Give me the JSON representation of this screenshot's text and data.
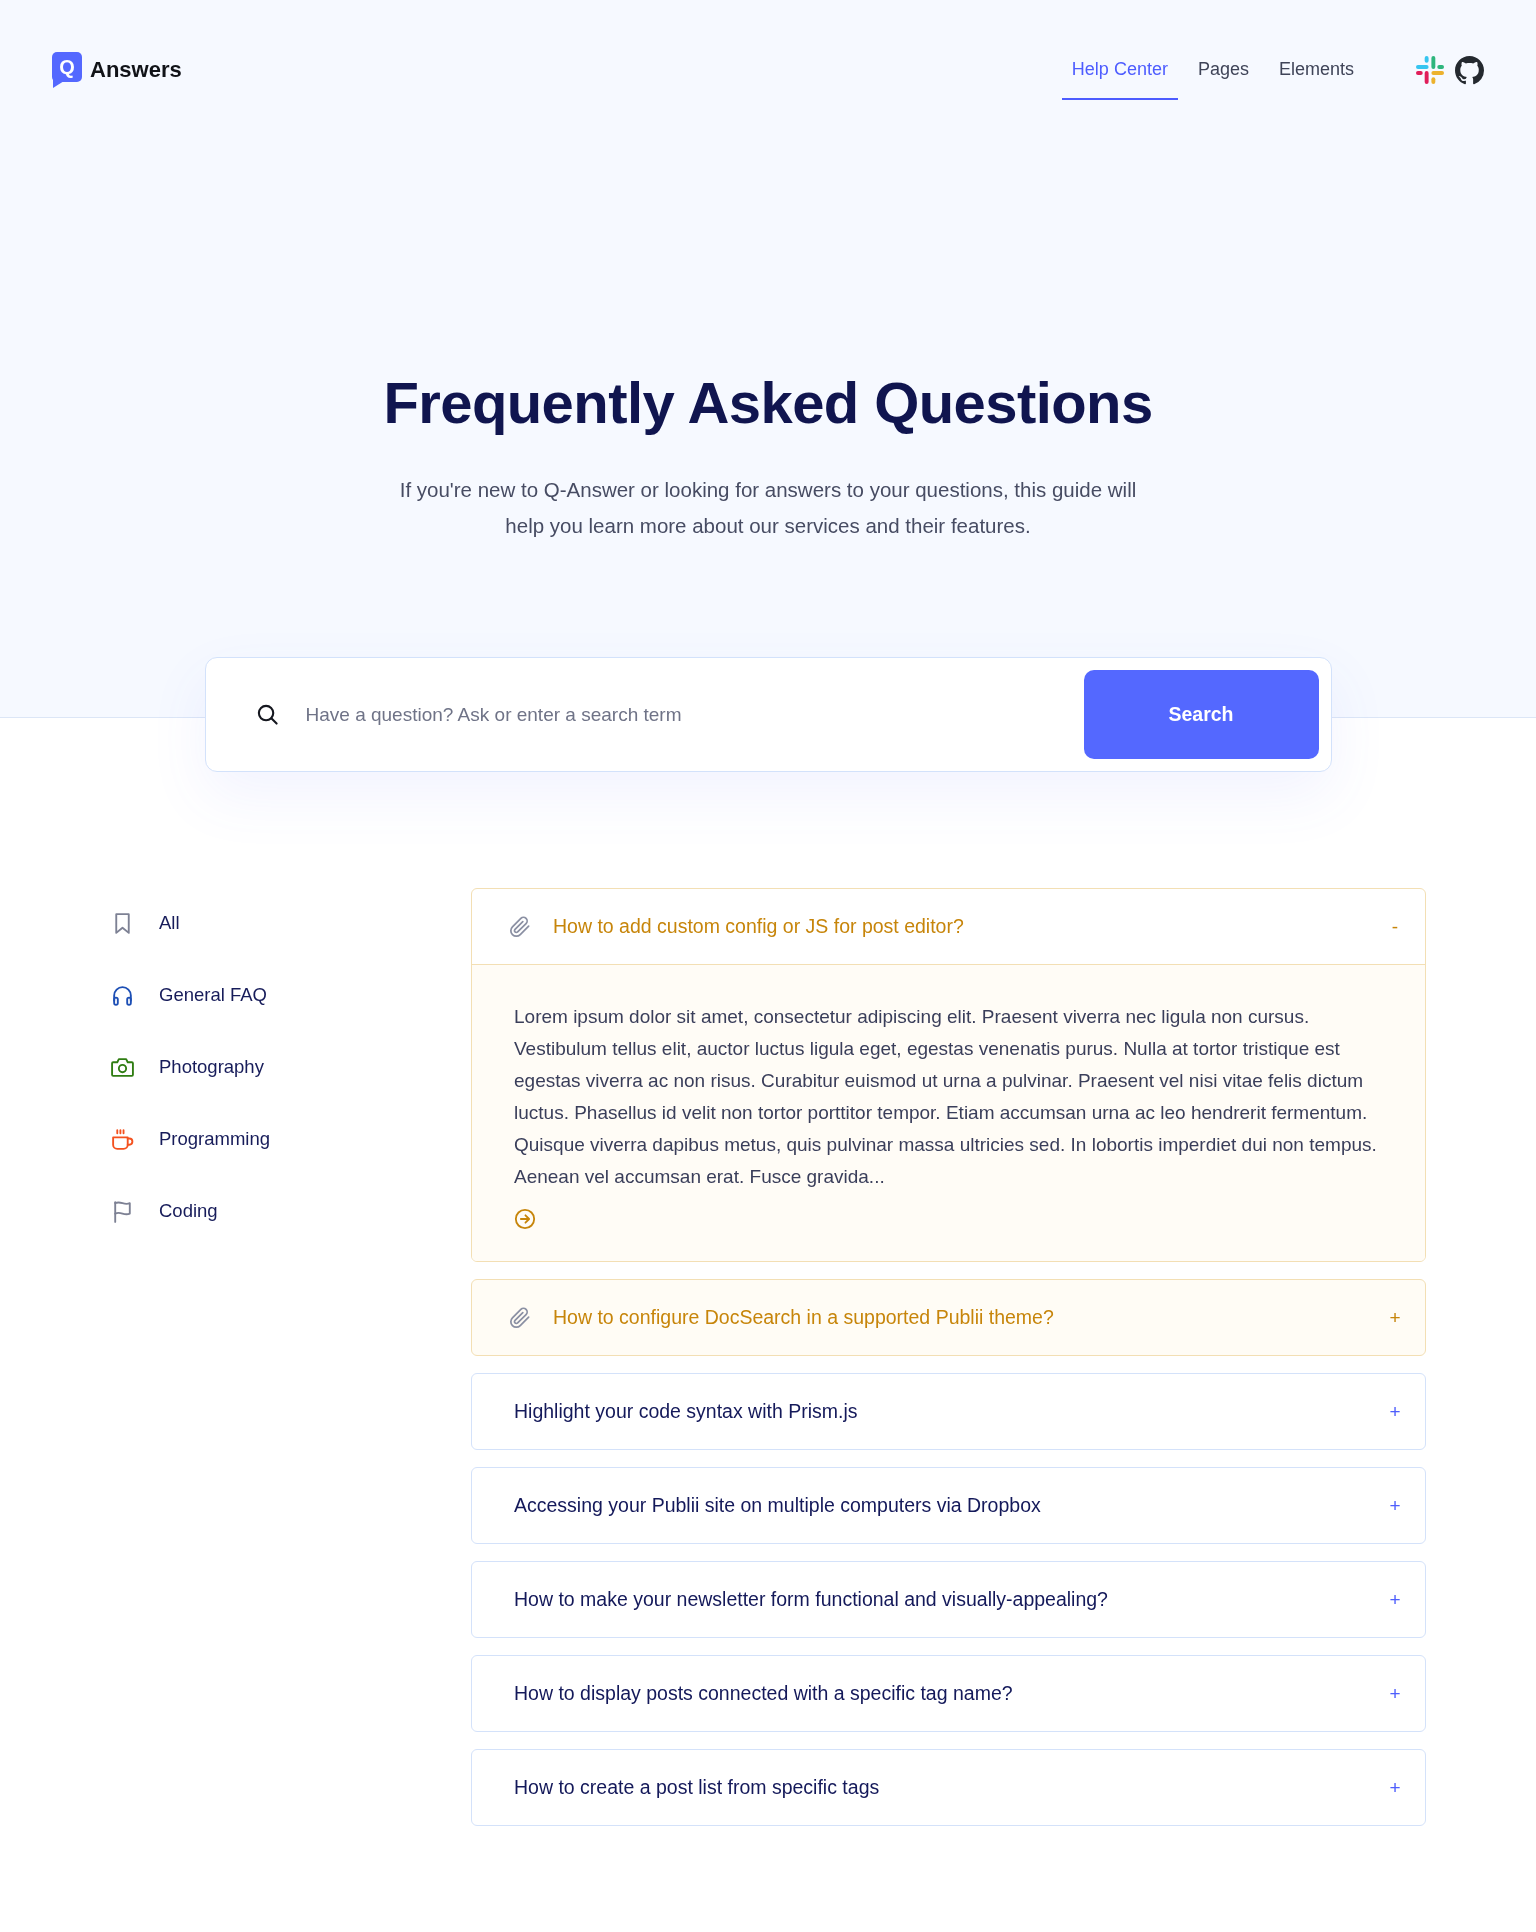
{
  "header": {
    "logo": {
      "mark": "Q",
      "name": "Answers"
    },
    "nav": [
      {
        "label": "Help Center",
        "selected": true
      },
      {
        "label": "Pages",
        "selected": false
      },
      {
        "label": "Elements",
        "selected": false
      }
    ]
  },
  "hero": {
    "title": "Frequently Asked Questions",
    "subtitle": "If you're new to Q-Answer or looking for answers to your questions, this guide will help you learn more about our services and their features."
  },
  "search": {
    "placeholder": "Have a question? Ask or enter a search term",
    "button": "Search"
  },
  "categories": [
    {
      "label": "All",
      "color": "#7d8194"
    },
    {
      "label": "General FAQ",
      "color": "#1d4fb5"
    },
    {
      "label": "Photography",
      "color": "#2f7d12"
    },
    {
      "label": "Programming",
      "color": "#f4511e"
    },
    {
      "label": "Coding",
      "color": "#7d8194"
    }
  ],
  "faqs": [
    {
      "kind": "attachment",
      "question": "How to add custom config or JS for post editor?",
      "toggle": "-",
      "expanded": true,
      "answer": "Lorem ipsum dolor sit amet, consectetur adipiscing elit. Praesent viverra nec ligula non cursus. Vestibulum tellus elit, auctor luctus ligula eget, egestas venenatis purus. Nulla at tortor tristique est egestas viverra ac non risus. Curabitur euismod ut urna a pulvinar. Praesent vel nisi vitae felis dictum luctus. Phasellus id velit non tortor porttitor tempor. Etiam accumsan urna ac leo hendrerit fermentum. Quisque viverra dapibus metus, quis pulvinar massa ultricies sed. In lobortis imperdiet dui non tempus. Aenean vel accumsan erat. Fusce gravida..."
    },
    {
      "kind": "attachment",
      "question": "How to configure DocSearch in a supported Publii theme?",
      "toggle": "+",
      "expanded": false
    },
    {
      "kind": "plain",
      "question": "Highlight your code syntax with Prism.js",
      "toggle": "+",
      "expanded": false
    },
    {
      "kind": "plain",
      "question": "Accessing your Publii site on multiple computers via Dropbox",
      "toggle": "+",
      "expanded": false
    },
    {
      "kind": "plain",
      "question": "How to make your newsletter form functional and visually-appealing?",
      "toggle": "+",
      "expanded": false
    },
    {
      "kind": "plain",
      "question": "How to display posts connected with a specific tag name?",
      "toggle": "+",
      "expanded": false
    },
    {
      "kind": "plain",
      "question": "How to create a post list from specific tags",
      "toggle": "+",
      "expanded": false
    }
  ]
}
